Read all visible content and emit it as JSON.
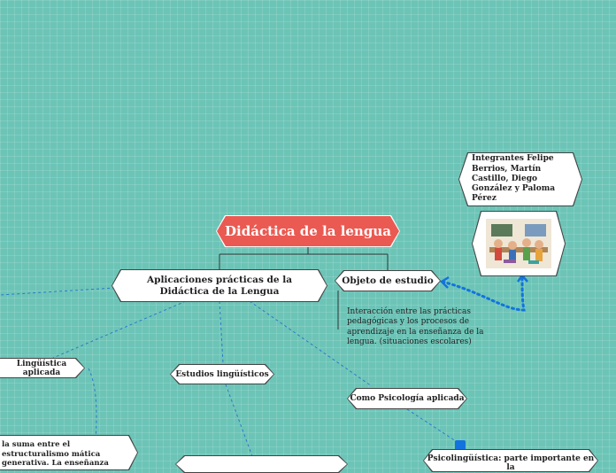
{
  "root": {
    "label": "Didáctica de la lengua"
  },
  "nodes": {
    "aplicaciones": "Aplicaciones prácticas de la Didáctica de la Lengua",
    "objeto": "Objeto de estudio",
    "integrantes": "Integrantes Felipe Berrios, Martín Castillo, Diego González y Paloma Pérez",
    "linguistica_aplicada": "Lingüística aplicada",
    "estudios_linguisticos": "Estudios lingüísticos",
    "psicologia_aplicada": "Como Psicología aplicada",
    "psicolinguistica": "Psicolingüística: parte importante en la",
    "suma_text": "la suma entre el estructuralismo mática generativa. La enseñanza"
  },
  "objeto_description": "Interacción entre las prácticas pedagógicas y los procesos de aprendizaje en la enseñanza de la lengua. (situaciones escolares)",
  "image": {
    "icon": "classroom-illustration"
  },
  "colors": {
    "background": "#6cc4b7",
    "root_fill": "#ea5a52",
    "connector_dash": "#2b79c9",
    "selection": "#1273de"
  }
}
